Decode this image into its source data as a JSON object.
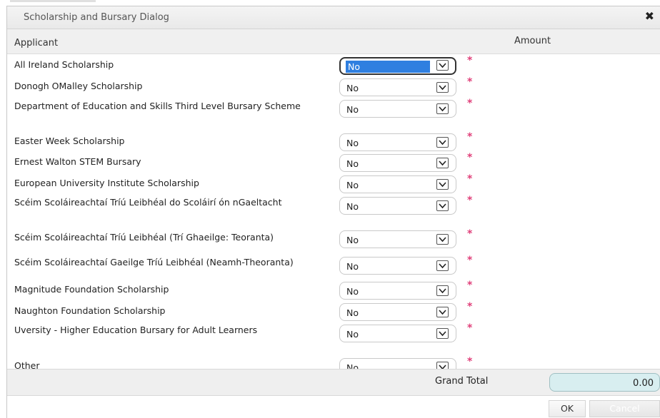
{
  "dialog": {
    "title": "Scholarship and Bursary Dialog",
    "close_glyph": "✖"
  },
  "columns": {
    "applicant": "Applicant",
    "amount": "Amount"
  },
  "rows": [
    {
      "label": "All Ireland Scholarship",
      "value": "No"
    },
    {
      "label": "Donogh OMalley Scholarship",
      "value": "No"
    },
    {
      "label": "Department of Education and Skills Third Level Bursary Scheme",
      "value": "No"
    },
    {
      "label": "Easter Week Scholarship",
      "value": "No"
    },
    {
      "label": "Ernest Walton STEM Bursary",
      "value": "No"
    },
    {
      "label": "European University Institute Scholarship",
      "value": "No"
    },
    {
      "label": "Scéim Scoláireachtaí Tríú Leibhéal do Scoláirí ón nGaeltacht",
      "value": "No"
    },
    {
      "label": "Scéim Scoláireachtaí Tríú Leibhéal (Trí Ghaeilge: Teoranta)",
      "value": "No"
    },
    {
      "label": "Scéim Scoláireachtaí Gaeilge Tríú Leibhéal (Neamh-Theoranta)",
      "value": "No"
    },
    {
      "label": "Magnitude Foundation Scholarship",
      "value": "No"
    },
    {
      "label": "Naughton Foundation Scholarship",
      "value": "No"
    },
    {
      "label": "Uversity - Higher Education Bursary for Adult Learners",
      "value": "No"
    },
    {
      "label": "Other",
      "value": "No"
    }
  ],
  "required_marker": "*",
  "footer": {
    "grand_total_label": "Grand Total",
    "grand_total_value": "0.00"
  },
  "buttons": {
    "ok": "OK",
    "cancel": "Cancel"
  },
  "colors": {
    "required": "#e0407a",
    "focus_highlight": "#2f7fe0",
    "total_field": "#d8eef0"
  }
}
